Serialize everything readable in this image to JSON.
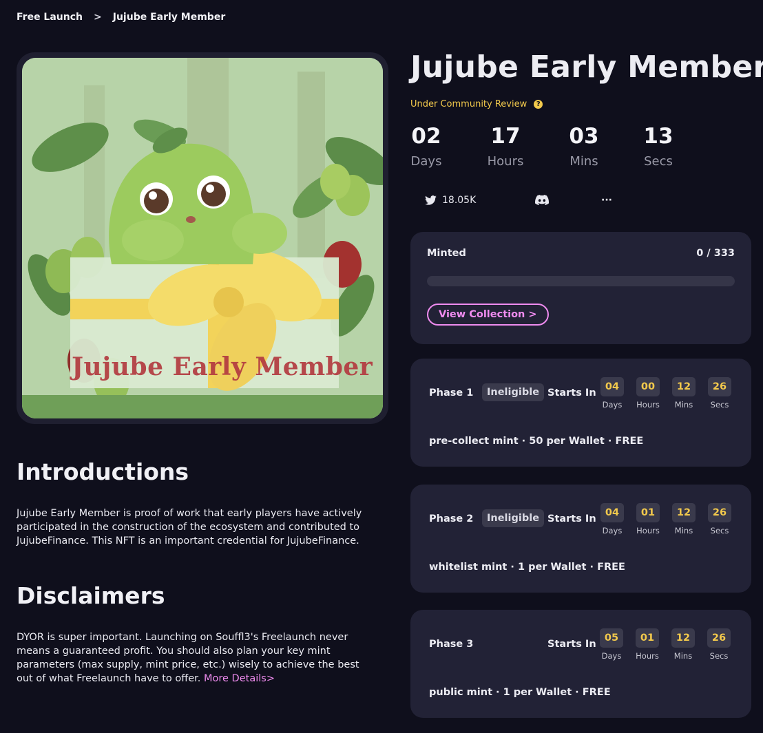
{
  "breadcrumb": {
    "root": "Free Launch",
    "separator": ">",
    "current": "Jujube Early Member"
  },
  "artwork": {
    "caption": "Jujube Early Member"
  },
  "title": "Jujube Early Member",
  "review_status": "Under Community Review",
  "countdown": [
    {
      "value": "02",
      "label": "Days"
    },
    {
      "value": "17",
      "label": "Hours"
    },
    {
      "value": "03",
      "label": "Mins"
    },
    {
      "value": "13",
      "label": "Secs"
    }
  ],
  "socials": {
    "twitter_followers": "18.05K",
    "more": "···"
  },
  "minted": {
    "label": "Minted",
    "count": "0 / 333",
    "progress_fraction": 0,
    "view_collection": "View Collection >"
  },
  "phases": [
    {
      "name": "Phase 1",
      "badge": "Ineligible",
      "starts_label": "Starts In",
      "countdown": [
        {
          "value": "04",
          "label": "Days"
        },
        {
          "value": "00",
          "label": "Hours"
        },
        {
          "value": "12",
          "label": "Mins"
        },
        {
          "value": "26",
          "label": "Secs"
        }
      ],
      "description": "pre-collect mint · 50 per Wallet · FREE"
    },
    {
      "name": "Phase 2",
      "badge": "Ineligible",
      "starts_label": "Starts In",
      "countdown": [
        {
          "value": "04",
          "label": "Days"
        },
        {
          "value": "01",
          "label": "Hours"
        },
        {
          "value": "12",
          "label": "Mins"
        },
        {
          "value": "26",
          "label": "Secs"
        }
      ],
      "description": "whitelist mint · 1 per Wallet · FREE"
    },
    {
      "name": "Phase 3",
      "badge": "",
      "starts_label": "Starts In",
      "countdown": [
        {
          "value": "05",
          "label": "Days"
        },
        {
          "value": "01",
          "label": "Hours"
        },
        {
          "value": "12",
          "label": "Mins"
        },
        {
          "value": "26",
          "label": "Secs"
        }
      ],
      "description": "public mint · 1 per Wallet · FREE"
    }
  ],
  "introductions": {
    "title": "Introductions",
    "text": "Jujube Early Member is proof of work that early players have actively participated in the construction of the ecosystem and contributed to JujubeFinance. This NFT is an important credential for JujubeFinance."
  },
  "disclaimers": {
    "title": "Disclaimers",
    "text": "DYOR is super important. Launching on Souffl3's Freelaunch never means a guaranteed profit. You should also plan your key mint parameters (max supply, mint price, etc.) wisely to achieve the best out of what Freelaunch have to offer. ",
    "link": "More Details>"
  },
  "colors": {
    "accent": "#f08cf0",
    "highlight": "#f2c94c",
    "background": "#0f0f1c",
    "card": "#222236"
  }
}
